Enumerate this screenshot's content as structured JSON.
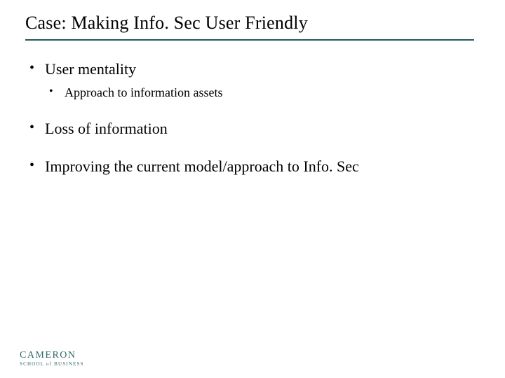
{
  "title": "Case: Making Info. Sec User Friendly",
  "bullets": [
    {
      "text": "User mentality",
      "children": [
        {
          "text": "Approach to information assets"
        }
      ]
    },
    {
      "text": "Loss of information"
    },
    {
      "text": "Improving the current model/approach to Info. Sec"
    }
  ],
  "logo": {
    "main": "CAMERON",
    "sub": "SCHOOL of BUSINESS"
  },
  "colors": {
    "rule": "#1f5b5a",
    "logo": "#2f6a68"
  }
}
